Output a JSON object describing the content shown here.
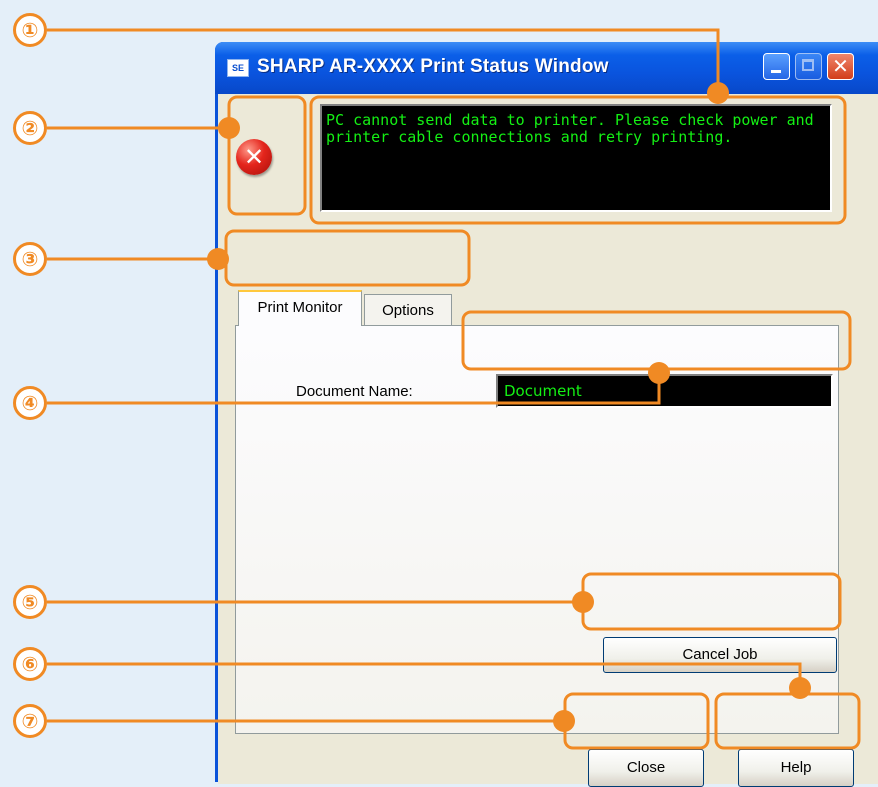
{
  "window": {
    "title": "SHARP AR-XXXX Print Status Window",
    "title_icon_text": "SE",
    "controls": {
      "minimize": "minimize-icon",
      "maximize": "maximize-icon",
      "close": "✕"
    }
  },
  "status": {
    "icon": "error-icon",
    "icon_glyph": "✕",
    "message": "PC cannot send data to printer. Please check power and printer cable connections and retry printing."
  },
  "tabs": [
    {
      "label": "Print Monitor",
      "selected": true
    },
    {
      "label": "Options",
      "selected": false
    }
  ],
  "print_monitor": {
    "document_name_label": "Document Name:",
    "document_name_value": "Document",
    "cancel_button": "Cancel Job"
  },
  "footer": {
    "close_button": "Close",
    "help_button": "Help"
  },
  "callouts": [
    "①",
    "②",
    "③",
    "④",
    "⑤",
    "⑥",
    "⑦"
  ],
  "colors": {
    "background": "#e4eff9",
    "titlebar": "#0a54de",
    "client": "#ece9d8",
    "display_text": "#14f014",
    "callout": "#f08a24"
  }
}
